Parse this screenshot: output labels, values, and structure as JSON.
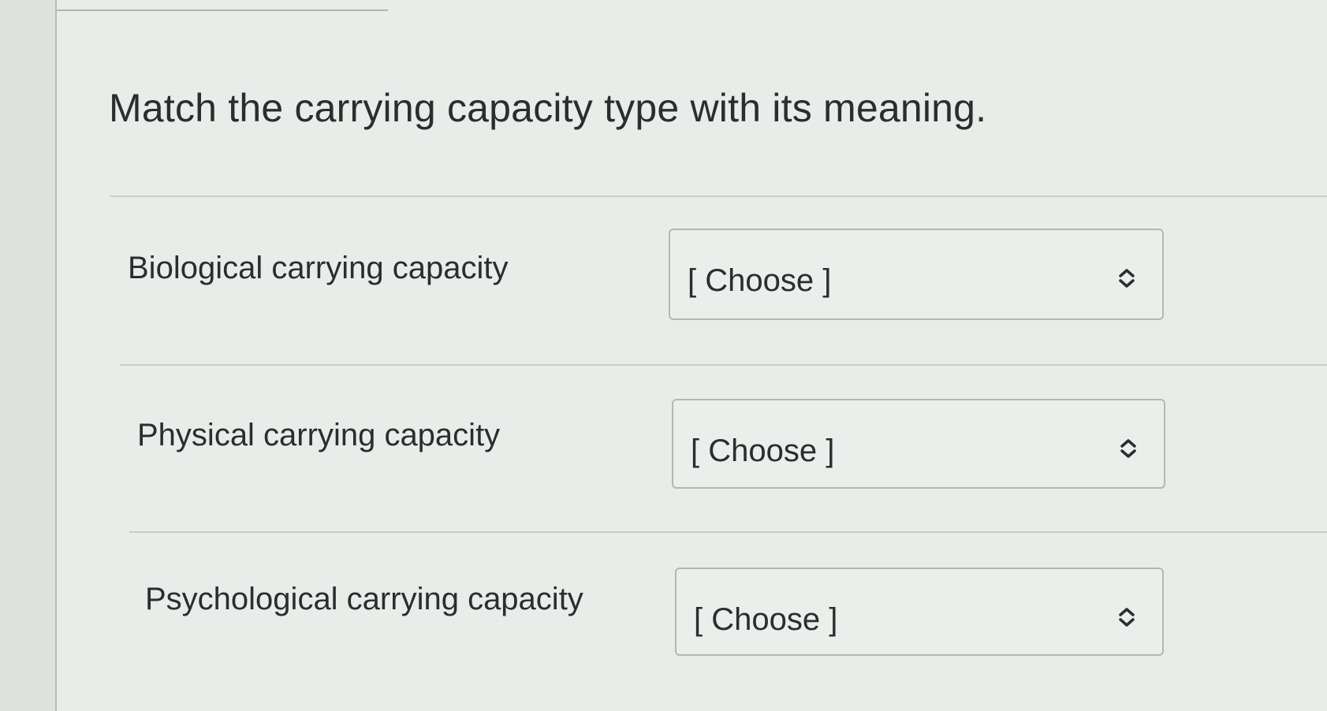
{
  "question": {
    "text": "Match the carrying capacity type with its meaning."
  },
  "rows": [
    {
      "label": "Biological carrying capacity",
      "select_value": "[ Choose ]",
      "icon": "updown-chevron-icon"
    },
    {
      "label": "Physical carrying capacity",
      "select_value": "[ Choose ]",
      "icon": "updown-chevron-icon"
    },
    {
      "label": "Psychological carrying capacity",
      "select_value": "[ Choose ]",
      "icon": "updown-chevron-icon"
    }
  ],
  "colors": {
    "text": "#2b2d2e",
    "background": "#eaecea",
    "select_border": "#b4b7b4"
  }
}
